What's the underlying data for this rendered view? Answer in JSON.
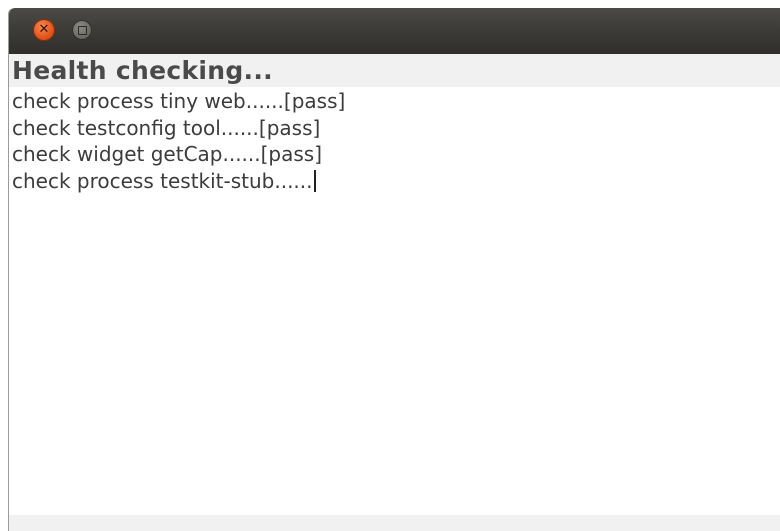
{
  "window": {
    "title_buttons": [
      {
        "name": "close",
        "icon": "close-icon",
        "glyph": "✕"
      },
      {
        "name": "maximize",
        "icon": "maximize-icon"
      }
    ]
  },
  "heading": "Health checking...",
  "log_lines": [
    "check process tiny web......[pass]",
    "check testconfig tool......[pass]",
    "check widget getCap......[pass]",
    "check process testkit-stub......"
  ],
  "colors": {
    "titlebar": "#3d3c38",
    "close_button": "#e2561c",
    "heading_band": "#f1f1f1",
    "text": "#3c3c3c"
  }
}
